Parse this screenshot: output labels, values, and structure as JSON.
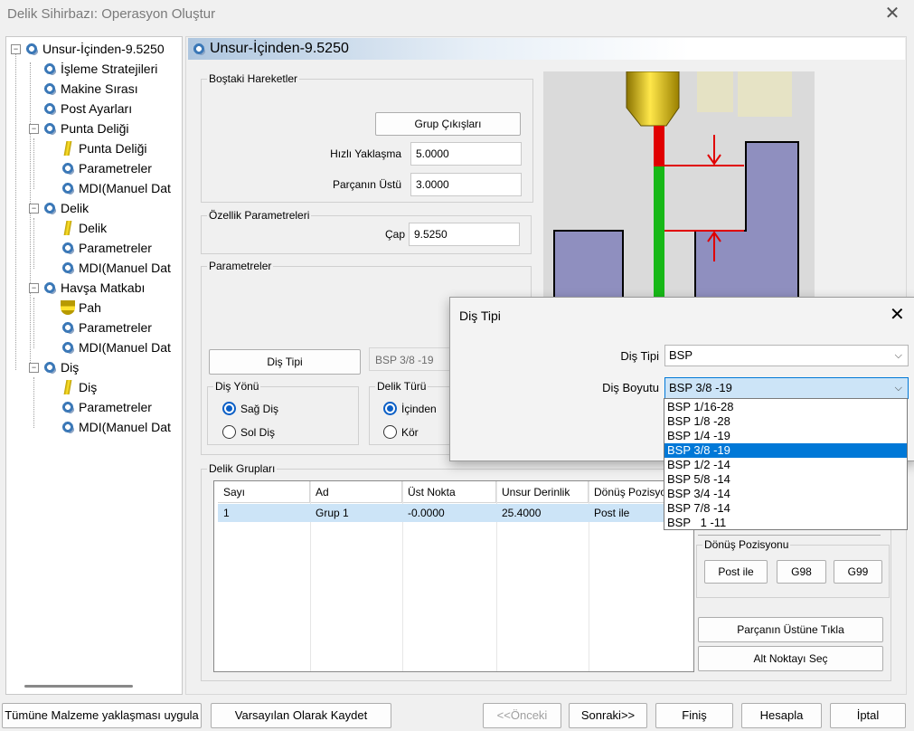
{
  "window": {
    "title": "Delik Sihirbazı: Operasyon Oluştur",
    "close": "✕"
  },
  "tree": {
    "root": "Unsur-İçinden-9.5250",
    "items": [
      {
        "label": "İşleme Stratejileri"
      },
      {
        "label": "Makine Sırası"
      },
      {
        "label": "Post Ayarları"
      },
      {
        "label": "Punta Deliği",
        "children": [
          "Punta Deliği",
          "Parametreler",
          "MDI(Manuel Dat"
        ]
      },
      {
        "label": "Delik",
        "children": [
          "Delik",
          "Parametreler",
          "MDI(Manuel Dat"
        ]
      },
      {
        "label": "Havşa Matkabı",
        "children": [
          "Pah",
          "Parametreler",
          "MDI(Manuel Dat"
        ]
      },
      {
        "label": "Diş",
        "children": [
          "Diş",
          "Parametreler",
          "MDI(Manuel Dat"
        ]
      }
    ]
  },
  "header": {
    "title": "Unsur-İçinden-9.5250"
  },
  "bostaki": {
    "legend": "Boştaki Hareketler",
    "group_button": "Grup Çıkışları",
    "hizli_label": "Hızlı Yaklaşma",
    "hizli_value": "5.0000",
    "parca_label": "Parçanın Üstü",
    "parca_value": "3.0000"
  },
  "ozellik": {
    "legend": "Özellik Parametreleri",
    "cap_label": "Çap",
    "cap_value": "9.5250"
  },
  "parametreler": {
    "legend": "Parametreler",
    "dis_tipi_button": "Diş Tipi",
    "dis_value": "BSP 3/8 -19",
    "dis_yonu_legend": "Diş Yönü",
    "sag": "Sağ Diş",
    "sol": "Sol Diş",
    "delik_turu_legend": "Delik Türü",
    "icinden": "İçinden",
    "kor": "Kör"
  },
  "gruplar": {
    "legend": "Delik Grupları",
    "columns": [
      "Sayı",
      "Ad",
      "Üst Nokta",
      "Unsur Derinlik",
      "Dönüş Pozisyo"
    ],
    "rows": [
      [
        "1",
        "Grup 1",
        "-0.0000",
        "25.4000",
        "Post ile"
      ]
    ]
  },
  "donus": {
    "legend": "Dönüş Pozisyonu",
    "post": "Post ile",
    "g98": "G98",
    "g99": "G99"
  },
  "side_buttons": {
    "parca": "Parçanın Üstüne Tıkla",
    "alt": "Alt Noktayı Seç"
  },
  "dialog": {
    "title": "Diş Tipi",
    "close": "✕",
    "dis_tipi_label": "Diş Tipi",
    "dis_tipi_value": "BSP",
    "dis_boyutu_label": "Diş Boyutu",
    "dis_boyutu_value": "BSP 3/8 -19",
    "options": [
      "BSP 1/16-28",
      "BSP 1/8 -28",
      "BSP 1/4 -19",
      "BSP 3/8 -19",
      "BSP 1/2 -14",
      "BSP 5/8 -14",
      "BSP 3/4 -14",
      "BSP 7/8 -14",
      "BSP   1 -11"
    ],
    "selected_index": 3
  },
  "bottom": {
    "tumune": "Tümüne Malzeme yaklaşması uygula",
    "varsayilan": "Varsayılan Olarak Kaydet",
    "onceki": "<<Önceki",
    "sonraki": "Sonraki>>",
    "finis": "Finiş",
    "hesapla": "Hesapla",
    "iptal": "İptal"
  },
  "colors": {
    "accent": "#0078d7",
    "header_gradient": "#aec6df",
    "selection_row": "#cce4f7"
  }
}
